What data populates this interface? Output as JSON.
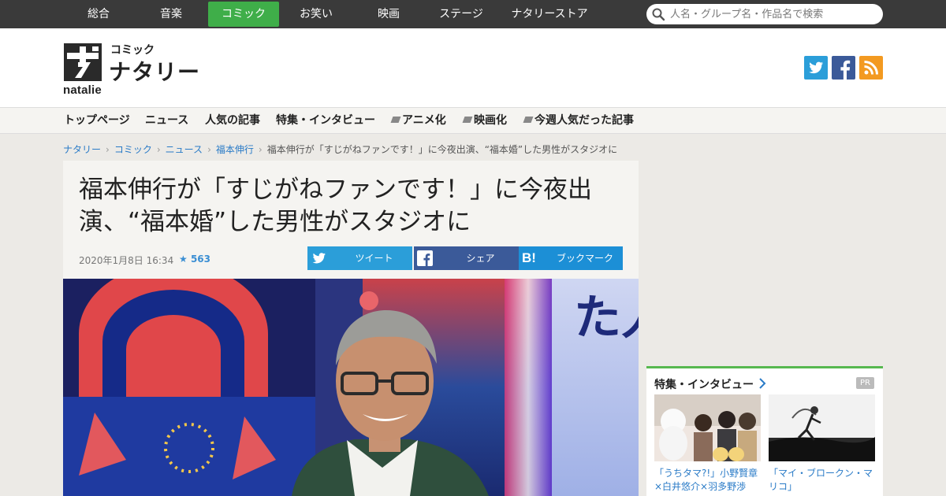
{
  "topnav": {
    "categories": [
      "総合",
      "音楽",
      "コミック",
      "お笑い",
      "映画",
      "ステージ",
      "ナタリーストア"
    ],
    "active": "コミック",
    "search_placeholder": "人名・グループ名・作品名で検索"
  },
  "header": {
    "logo_latin": "natalie",
    "logo_sub": "コミック",
    "logo_main": "ナタリー",
    "social_icons": [
      "twitter-icon",
      "facebook-icon",
      "rss-icon"
    ]
  },
  "section_nav": {
    "items": [
      "トップページ",
      "ニュース",
      "人気の記事",
      "特集・インタビュー",
      "アニメ化",
      "映画化",
      "今週人気だった記事"
    ]
  },
  "breadcrumb": {
    "links": [
      "ナタリー",
      "コミック",
      "ニュース",
      "福本伸行"
    ],
    "current": "福本伸行が「すじがねファンです！」に今夜出演、“福本婚”した男性がスタジオに"
  },
  "article": {
    "title": "福本伸行が「すじがねファンです！」に今夜出演、“福本婚”した男性がスタジオに",
    "date": "2020年1月8日 16:34",
    "star_count": "563",
    "share": {
      "tweet": "ツイート",
      "facebook": "シェア",
      "hatena_mark": "B!",
      "bookmark": "ブックマーク"
    },
    "photo_text": "た人生"
  },
  "sidebar": {
    "title": "特集・インタビュー",
    "badge": "PR",
    "items": [
      {
        "caption": "「うちタマ?!」小野賢章×白井悠介×羽多野渉"
      },
      {
        "caption": "「マイ・ブロークン・マリコ」"
      }
    ]
  },
  "colors": {
    "topbar": "#3a3a3a",
    "active_category": "#3fae49",
    "twitter": "#2b9ed9",
    "facebook": "#3b5a99",
    "rss": "#f39a21",
    "link": "#2a7bc7",
    "widget_accent": "#57b84f"
  }
}
